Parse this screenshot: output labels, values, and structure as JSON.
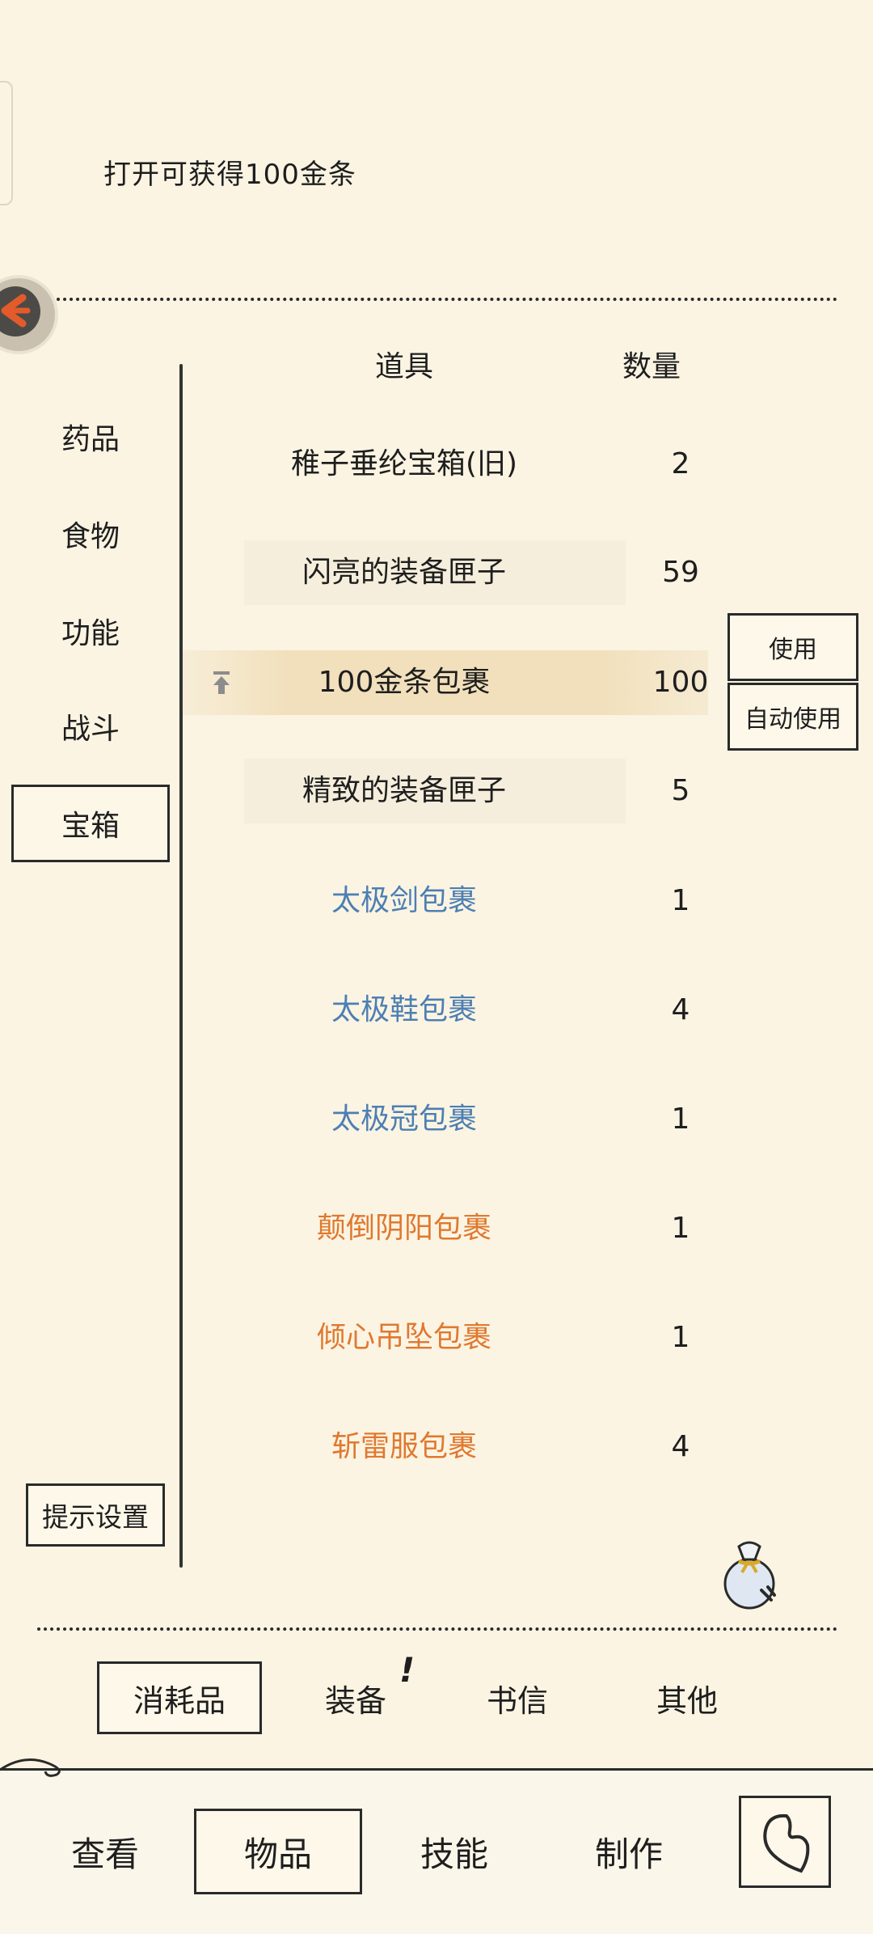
{
  "description": "打开可获得100金条",
  "headers": {
    "item": "道具",
    "quantity": "数量"
  },
  "categories": [
    {
      "label": "药品",
      "selected": false
    },
    {
      "label": "食物",
      "selected": false
    },
    {
      "label": "功能",
      "selected": false
    },
    {
      "label": "战斗",
      "selected": false
    },
    {
      "label": "宝箱",
      "selected": true
    }
  ],
  "items": [
    {
      "name": "稚子垂纶宝箱(旧)",
      "qty": "2",
      "color": "#1e1e1e"
    },
    {
      "name": "闪亮的装备匣子",
      "qty": "59",
      "color": "#1e1e1e"
    },
    {
      "name": "100金条包裹",
      "qty": "100",
      "color": "#1e1e1e",
      "selected": true
    },
    {
      "name": "精致的装备匣子",
      "qty": "5",
      "color": "#1e1e1e"
    },
    {
      "name": "太极剑包裹",
      "qty": "1",
      "color": "#4d7fb2"
    },
    {
      "name": "太极鞋包裹",
      "qty": "4",
      "color": "#4d7fb2"
    },
    {
      "name": "太极冠包裹",
      "qty": "1",
      "color": "#4d7fb2"
    },
    {
      "name": "颠倒阴阳包裹",
      "qty": "1",
      "color": "#e0792f"
    },
    {
      "name": "倾心吊坠包裹",
      "qty": "1",
      "color": "#e0792f"
    },
    {
      "name": "斩雷服包裹",
      "qty": "4",
      "color": "#e0792f"
    }
  ],
  "actions": {
    "use": "使用",
    "auto_use": "自动使用"
  },
  "hint_settings": "提示设置",
  "sub_tabs": [
    {
      "label": "消耗品",
      "selected": true
    },
    {
      "label": "装备",
      "selected": false
    },
    {
      "label": "书信",
      "selected": false
    },
    {
      "label": "其他",
      "selected": false
    }
  ],
  "alert_mark": "!",
  "nav": [
    {
      "label": "查看",
      "selected": false
    },
    {
      "label": "物品",
      "selected": true
    },
    {
      "label": "技能",
      "selected": false
    },
    {
      "label": "制作",
      "selected": false
    }
  ],
  "icons": {
    "back": "back-arrow-icon",
    "pin": "pin-top-icon",
    "bag": "pouch-icon",
    "heart": "heart-icon"
  }
}
